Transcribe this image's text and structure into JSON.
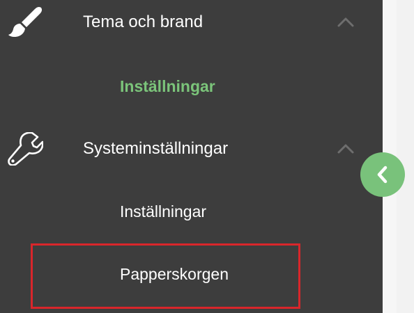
{
  "sidebar": {
    "sections": [
      {
        "icon": "paintbrush-icon",
        "label": "Tema och brand",
        "expanded": true,
        "items": [
          {
            "label": "Inställningar",
            "active": true
          }
        ]
      },
      {
        "icon": "wrench-icon",
        "label": "Systeminställningar",
        "expanded": true,
        "items": [
          {
            "label": "Inställningar",
            "active": false
          },
          {
            "label": "Papperskorgen",
            "active": false,
            "highlighted": true
          }
        ]
      }
    ],
    "collapse_button": {
      "icon": "chevron-left-icon"
    }
  },
  "colors": {
    "sidebar_bg": "#3d3d3d",
    "accent_green": "#79c27b",
    "active_text": "#7bc47a",
    "highlight_border": "#d9262b",
    "text": "#ffffff"
  }
}
